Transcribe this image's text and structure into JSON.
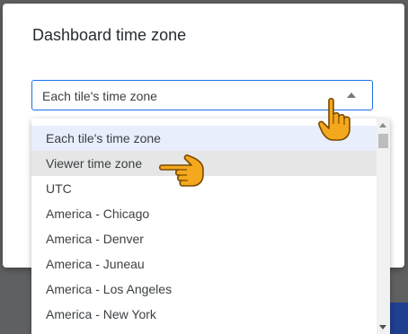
{
  "dialog": {
    "title": "Dashboard time zone"
  },
  "select": {
    "value": "Each tile's time zone"
  },
  "dropdown": {
    "options": [
      "Each tile's time zone",
      "Viewer time zone",
      "UTC",
      "America - Chicago",
      "America - Denver",
      "America - Juneau",
      "America - Los Angeles",
      "America - New York"
    ]
  },
  "colors": {
    "accent": "#1a73e8",
    "backdrop": "#5f6062",
    "cursor": "#f4a81d"
  },
  "icons": [
    "caret-up-icon",
    "scroll-up-icon",
    "scroll-down-icon",
    "hand-pointer-icon"
  ]
}
